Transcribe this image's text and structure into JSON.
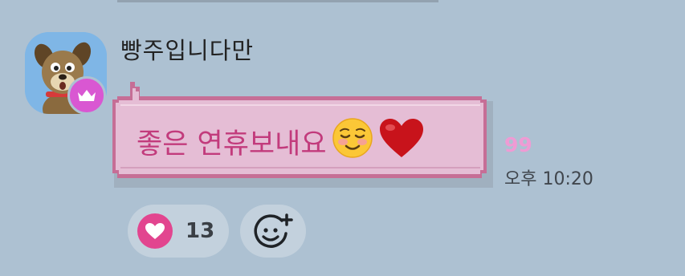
{
  "sender": {
    "name": "빵주입니다만"
  },
  "message": {
    "text": "좋은 연휴보내요",
    "emojis": [
      "smiling-face-icon",
      "red-heart-icon"
    ],
    "unread_count": "99",
    "time": "오후 10:20"
  },
  "reactions": {
    "heart_count": "13"
  },
  "colors": {
    "background": "#adc1d2",
    "bubble_fill": "#e5bdd5",
    "bubble_border": "#c66e96",
    "message_text": "#c23b7c",
    "unread": "#ef9bd4",
    "crown_badge": "#d957d2",
    "reaction_heart": "#e2458f"
  }
}
